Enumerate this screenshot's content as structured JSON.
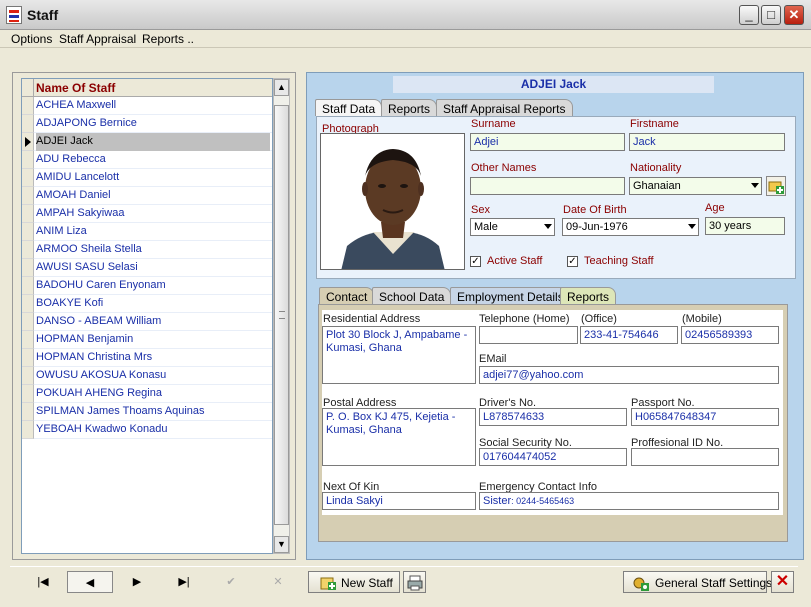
{
  "window": {
    "title": "Staff",
    "minimize": "_",
    "maximize": "□",
    "close": "✕"
  },
  "menu": {
    "options": "Options",
    "appraisal": "Staff Appraisal",
    "reports": "Reports .."
  },
  "staff_list": {
    "header": "Name Of Staff",
    "rows": [
      "ACHEA Maxwell",
      "ADJAPONG Bernice",
      "ADJEI Jack",
      "ADU Rebecca",
      "AMIDU Lancelott",
      "AMOAH Daniel",
      "AMPAH Sakyiwaa",
      "ANIM Liza",
      "ARMOO Sheila Stella",
      "AWUSI SASU Selasi",
      "BADOHU Caren Enyonam",
      "BOAKYE Kofi",
      "DANSO - ABEAM William",
      "HOPMAN Benjamin",
      "HOPMAN Christina Mrs",
      "OWUSU AKOSUA Konasu",
      "POKUAH AHENG Regina",
      "SPILMAN James Thoams Aquinas",
      "YEBOAH Kwadwo Konadu"
    ],
    "selected_index": 2,
    "scroll_up": "▲",
    "scroll_down": "▼"
  },
  "detail": {
    "name_header": "ADJEI Jack",
    "tabs": [
      "Staff Data",
      "Reports",
      "Staff Appraisal Reports"
    ],
    "photograph_label": "Photograph",
    "surname_label": "Surname",
    "surname": "Adjei",
    "firstname_label": "Firstname",
    "firstname": "Jack",
    "other_names_label": "Other Names",
    "other_names": "",
    "nationality_label": "Nationality",
    "nationality": "Ghanaian",
    "sex_label": "Sex",
    "sex": "Male",
    "dob_label": "Date Of Birth",
    "dob": "09-Jun-1976",
    "age_label": "Age",
    "age": "30 years",
    "active_label": "Active Staff",
    "active_checked": "✓",
    "teaching_label": "Teaching Staff",
    "teaching_checked": "✓"
  },
  "contact": {
    "tabs": [
      "Contact",
      "School Data",
      "Employment Details",
      "Reports"
    ],
    "res_address_label": "Residential Address",
    "res_address": "Plot 30 Block J, Ampabame - Kumasi, Ghana",
    "tel_home_label": "Telephone (Home)",
    "tel_home": "",
    "office_label": "(Office)",
    "office": "233-41-754646",
    "mobile_label": "(Mobile)",
    "mobile": "02456589393",
    "email_label": "EMail",
    "email": "adjei77@yahoo.com",
    "postal_label": "Postal Address",
    "postal": "P. O. Box KJ 475, Kejetia - Kumasi, Ghana",
    "drivers_label": "Driver's No.",
    "drivers": "L878574633",
    "passport_label": "Passport No.",
    "passport": "H065847648347",
    "ssn_label": "Social Security No.",
    "ssn": "017604474052",
    "prof_label": "Proffesional ID No.",
    "prof": "",
    "kin_label": "Next Of Kin",
    "kin": "Linda Sakyi",
    "emergency_label": "Emergency Contact Info",
    "emergency_name": "Sister",
    "emergency_phone": ": 0244-5465463"
  },
  "toolbar": {
    "first": "|◀",
    "prev": "◀",
    "next": "▶",
    "last": "▶|",
    "confirm": "✔",
    "cancel": "✕",
    "new_staff": "New Staff",
    "general_settings": "General Staff Settings",
    "close": "✕"
  }
}
